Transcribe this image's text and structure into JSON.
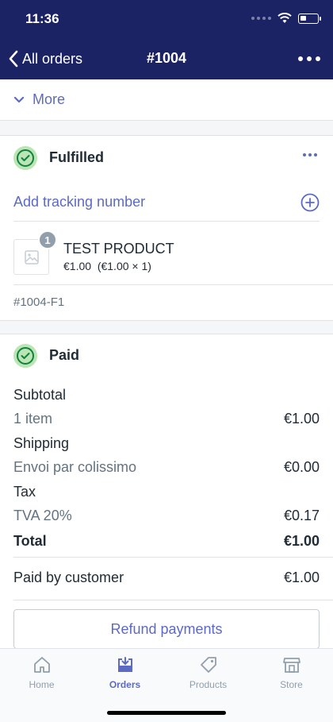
{
  "status": {
    "time": "11:36"
  },
  "nav": {
    "back_label": "All orders",
    "title": "#1004"
  },
  "more": {
    "label": "More"
  },
  "fulfilled": {
    "title": "Fulfilled",
    "tracking_label": "Add tracking number",
    "product": {
      "name": "TEST PRODUCT",
      "price": "€1.00  (€1.00 × 1)",
      "quantity": "1"
    },
    "fulfillment_id": "#1004-F1"
  },
  "paid": {
    "title": "Paid",
    "subtotal_label": "Subtotal",
    "subtotal_detail": "1 item",
    "subtotal_value": "€1.00",
    "shipping_label": "Shipping",
    "shipping_detail": "Envoi par colissimo",
    "shipping_value": "€0.00",
    "tax_label": "Tax",
    "tax_detail": "TVA 20%",
    "tax_value": "€0.17",
    "total_label": "Total",
    "total_value": "€1.00",
    "paid_by_label": "Paid by customer",
    "paid_by_value": "€1.00",
    "refund_label": "Refund payments"
  },
  "tabs": [
    {
      "label": "Home",
      "icon": "home-icon"
    },
    {
      "label": "Orders",
      "icon": "orders-icon",
      "active": true
    },
    {
      "label": "Products",
      "icon": "tag-icon"
    },
    {
      "label": "Store",
      "icon": "store-icon"
    }
  ],
  "colors": {
    "nav_bg": "#1b2364",
    "accent": "#5c6ac4",
    "success": "#108043",
    "success_bg": "#bbe5b3"
  }
}
